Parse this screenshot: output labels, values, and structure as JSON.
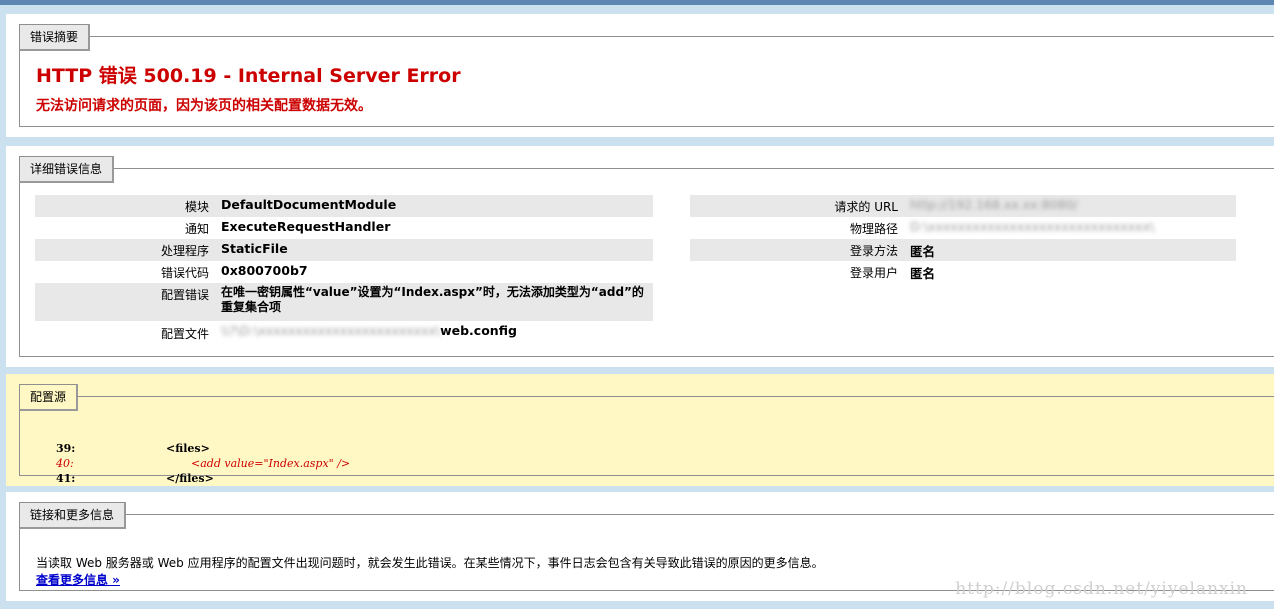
{
  "summary": {
    "legend": "错误摘要",
    "title": "HTTP 错误 500.19 - Internal Server Error",
    "subtitle": "无法访问请求的页面，因为该页的相关配置数据无效。"
  },
  "details": {
    "legend": "详细错误信息",
    "left": [
      {
        "key": "模块",
        "value": "DefaultDocumentModule"
      },
      {
        "key": "通知",
        "value": "ExecuteRequestHandler"
      },
      {
        "key": "处理程序",
        "value": "StaticFile"
      },
      {
        "key": "错误代码",
        "value": "0x800700b7"
      },
      {
        "key": "配置错误",
        "value": "在唯一密钥属性“value”设置为“Index.aspx”时，无法添加类型为“add”的重复集合项"
      },
      {
        "key": "配置文件",
        "blurred": "\\\\?\\D:\\xxxxxxxxxxxxxxxxxxxxxxxx\\",
        "value": "web.config"
      }
    ],
    "right": [
      {
        "key": "请求的 URL",
        "blurred": "http://192.168.xx.xx:8080/"
      },
      {
        "key": "物理路径",
        "blurred": "D:\\xxxxxxxxxxxxxxxxxxxxxxxxxxxxxx\\"
      },
      {
        "key": "登录方法",
        "value": "匿名"
      },
      {
        "key": "登录用户",
        "value": "匿名"
      }
    ]
  },
  "config_source": {
    "legend": "配置源",
    "lines": [
      {
        "num": "39:",
        "text": "<files>",
        "error": false
      },
      {
        "num": "40:",
        "text": "<add value=\"Index.aspx\" />",
        "error": true
      },
      {
        "num": "41:",
        "text": "</files>",
        "error": false
      }
    ]
  },
  "more_info": {
    "legend": "链接和更多信息",
    "description": "当读取 Web 服务器或 Web 应用程序的配置文件出现问题时，就会发生此错误。在某些情况下，事件日志会包含有关导致此错误的原因的更多信息。",
    "link": "查看更多信息 »"
  },
  "watermark": "http://blog.csdn.net/yiyelanxin"
}
